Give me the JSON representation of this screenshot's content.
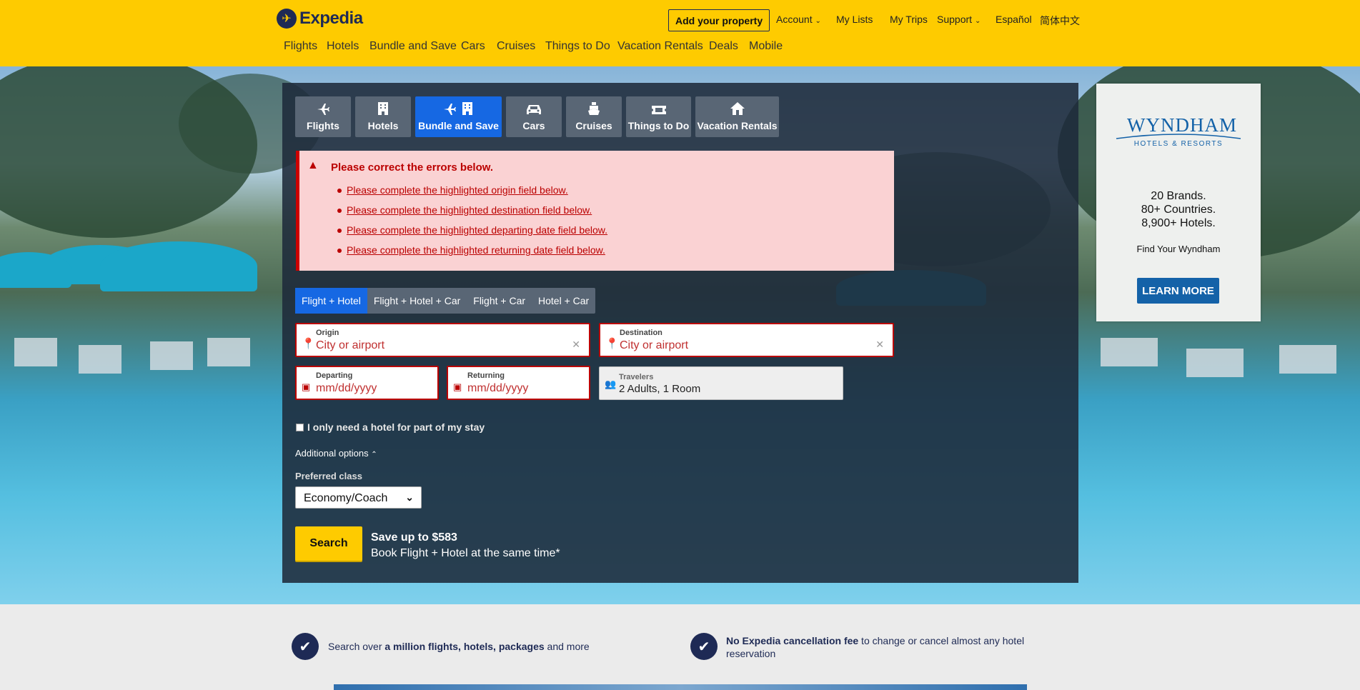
{
  "header": {
    "logo_text": "Expedia",
    "add_property": "Add your property",
    "top_links": [
      "Account",
      "My Lists",
      "My Trips",
      "Support",
      "Español",
      "简体中文"
    ],
    "nav": [
      "Flights",
      "Hotels",
      "Bundle and Save",
      "Cars",
      "Cruises",
      "Things to Do",
      "Vacation Rentals",
      "Deals",
      "Mobile"
    ]
  },
  "search": {
    "tabs": [
      {
        "label": "Flights",
        "icon": "plane-icon"
      },
      {
        "label": "Hotels",
        "icon": "building-icon"
      },
      {
        "label": "Bundle and Save",
        "icon": "bundle-icon"
      },
      {
        "label": "Cars",
        "icon": "car-icon"
      },
      {
        "label": "Cruises",
        "icon": "ship-icon"
      },
      {
        "label": "Things to Do",
        "icon": "ticket-icon"
      },
      {
        "label": "Vacation Rentals",
        "icon": "house-icon"
      }
    ],
    "active_tab": "Bundle and Save",
    "errors": {
      "title": "Please correct the errors below.",
      "items": [
        "Please complete the highlighted origin field below.",
        "Please complete the highlighted destination field below.",
        "Please complete the highlighted departing date field below.",
        "Please complete the highlighted returning date field below."
      ]
    },
    "subtabs": [
      "Flight + Hotel",
      "Flight + Hotel + Car",
      "Flight + Car",
      "Hotel + Car"
    ],
    "active_subtab": "Flight + Hotel",
    "origin": {
      "label": "Origin",
      "placeholder": "City or airport"
    },
    "destination": {
      "label": "Destination",
      "placeholder": "City or airport"
    },
    "departing": {
      "label": "Departing",
      "placeholder": "mm/dd/yyyy"
    },
    "returning": {
      "label": "Returning",
      "placeholder": "mm/dd/yyyy"
    },
    "travelers": {
      "label": "Travelers",
      "value": "2 Adults, 1 Room"
    },
    "partial_stay": "I only need a hotel for part of my stay",
    "additional_options": "Additional options",
    "preferred_class_label": "Preferred class",
    "preferred_class_value": "Economy/Coach",
    "search_button": "Search",
    "promo_title": "Save up to $583",
    "promo_sub": "Book Flight + Hotel at the same time*"
  },
  "ad": {
    "brand": "WYNDHAM",
    "brand_sub": "HOTELS & RESORTS",
    "lines": [
      "20 Brands.",
      "80+ Countries.",
      "8,900+ Hotels."
    ],
    "tagline": "Find Your Wyndham",
    "cta": "LEARN MORE"
  },
  "features": {
    "f1_pre": "Search over ",
    "f1_bold": "a million flights, hotels, packages",
    "f1_post": " and more",
    "f2_bold": "No Expedia cancellation fee",
    "f2_post": " to change or cancel almost any hotel reservation"
  },
  "colors": {
    "brand_yellow": "#fecb00",
    "brand_navy": "#1e2a55",
    "active_blue": "#1668e3",
    "error_red": "#b00000"
  }
}
